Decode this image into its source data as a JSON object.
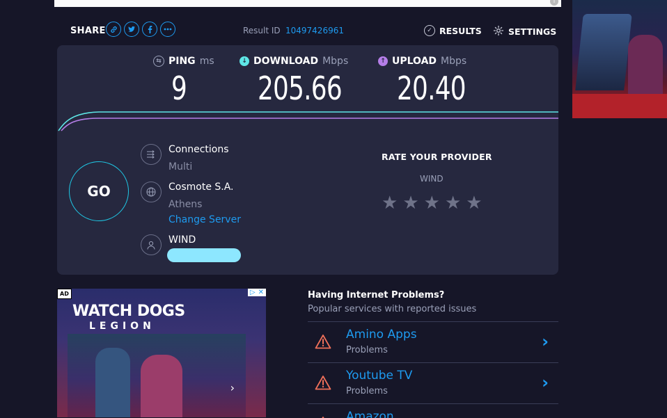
{
  "header": {
    "share_label": "SHARE",
    "share_icons": [
      "link-icon",
      "twitter-icon",
      "facebook-icon",
      "more-icon"
    ],
    "result_label": "Result ID",
    "result_id": "10497426961",
    "results_label": "RESULTS",
    "settings_label": "SETTINGS"
  },
  "metrics": {
    "ping": {
      "label": "PING",
      "unit": "ms",
      "value": "9"
    },
    "download": {
      "label": "DOWNLOAD",
      "unit": "Mbps",
      "value": "205.66"
    },
    "upload": {
      "label": "UPLOAD",
      "unit": "Mbps",
      "value": "20.40"
    }
  },
  "go_label": "GO",
  "connection": {
    "connections_label": "Connections",
    "connections_value": "Multi",
    "server_name": "Cosmote S.A.",
    "server_city": "Athens",
    "change_server": "Change Server",
    "provider": "WIND"
  },
  "rating": {
    "title": "RATE YOUR PROVIDER",
    "provider": "WIND",
    "stars": 5,
    "filled": 0
  },
  "ad": {
    "badge": "AD",
    "title_line1": "WATCH DOGS",
    "title_line2": "LEGION"
  },
  "problems": {
    "title": "Having Internet Problems?",
    "subtitle": "Popular services with reported issues",
    "items": [
      {
        "name": "Amino Apps",
        "status": "Problems"
      },
      {
        "name": "Youtube TV",
        "status": "Problems"
      },
      {
        "name": "Amazon",
        "status": ""
      }
    ]
  },
  "colors": {
    "background": "#161628",
    "panel": "#26283f",
    "accent_blue": "#1e9bf0",
    "download_line": "#5ee6e6",
    "upload_line": "#b57ee8",
    "warning": "#f0705a"
  }
}
